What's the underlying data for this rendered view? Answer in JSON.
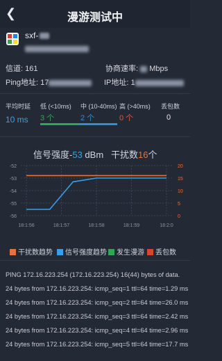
{
  "header": {
    "title": "漫游测试中",
    "back_icon": "chevron-left-icon"
  },
  "ap": {
    "ssid": "sxf-",
    "icon": "access-point-icon"
  },
  "info": {
    "channel_label": "信道:",
    "channel_value": "161",
    "rate_label": "协商速率:",
    "rate_value": "Mbps",
    "ping_label": "Ping地址:",
    "ping_value": "17",
    "ip_label": "IP地址:",
    "ip_value": "1"
  },
  "stats": {
    "avg_label": "平均时延",
    "avg_value": "10 ms",
    "low_label": "低 (<10ms)",
    "low_value": "3 个",
    "mid_label": "中 (10-40ms)",
    "mid_value": "2 个",
    "high_label": "高 (>40ms)",
    "high_value": "0 个",
    "loss_label": "丢包数",
    "loss_value": "0",
    "colors": {
      "low": "#2fa84f",
      "mid": "#2f8fd6",
      "high": "#e3533b"
    }
  },
  "chart_data": {
    "type": "line",
    "title_signal_label": "信号强度-",
    "title_signal_value": "53",
    "title_signal_unit": " dBm",
    "title_interference_label": "干扰数",
    "title_interference_value": "16",
    "title_interference_unit": "个",
    "x": [
      "18:1:56",
      "18:1:57",
      "18:1:58",
      "18:1:59",
      "18:2:0"
    ],
    "y_left_ticks": [
      "-52",
      "-53",
      "-54",
      "-55",
      "-56"
    ],
    "y_right_ticks": [
      "20",
      "15",
      "10",
      "5",
      "0"
    ],
    "ylim_left": [
      -56,
      -52
    ],
    "ylim_right": [
      0,
      20
    ],
    "series": [
      {
        "name": "干扰数趋势",
        "color": "#e8713c",
        "axis": "right",
        "values": [
          16,
          16,
          16,
          16,
          16,
          16,
          16
        ]
      },
      {
        "name": "信号强度趋势",
        "color": "#3a9ee6",
        "axis": "left",
        "values": [
          -55.5,
          -55.5,
          -53.3,
          -53.0,
          -53.0,
          -53.0,
          -53.0
        ]
      },
      {
        "name": "发生漫游",
        "color": "#2fa84f",
        "values": []
      },
      {
        "name": "丢包数",
        "color": "#d9432f",
        "values": []
      }
    ]
  },
  "log": [
    "PING 172.16.223.254 (172.16.223.254) 16(44) bytes of data.",
    "24 bytes from 172.16.223.254: icmp_seq=1 ttl=64 time=1.29 ms",
    "24 bytes from 172.16.223.254: icmp_seq=2 ttl=64 time=26.0 ms",
    "24 bytes from 172.16.223.254: icmp_seq=3 ttl=64 time=2.42 ms",
    "24 bytes from 172.16.223.254: icmp_seq=4 ttl=64 time=2.96 ms",
    "24 bytes from 172.16.223.254: icmp_seq=5 ttl=64 time=17.7 ms"
  ]
}
